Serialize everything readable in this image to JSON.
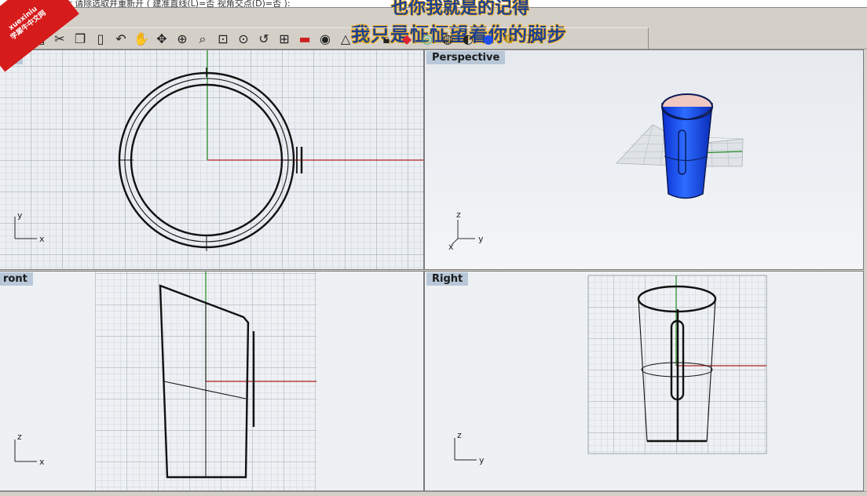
{
  "command_line": "ter 请除选取并重新开 ( 建准直线(L)=否  视角交点(D)=否 ):",
  "banner_top": "也你我就是的记得",
  "banner": "我只是怔怔望着你的脚步",
  "watermark": {
    "line1": "xuexiniu",
    "line2": "学犀牛中文网"
  },
  "toolbar": {
    "icons": [
      "print-icon",
      "page-setup-icon",
      "cut-icon",
      "copy-icon",
      "paste-icon",
      "undo-icon",
      "pan-hand-icon",
      "rotate-view-icon",
      "zoom-icon",
      "zoom-window-icon",
      "zoom-extents-icon",
      "zoom-selected-icon",
      "undo-view-icon",
      "four-viewports-icon",
      "car-icon",
      "construction-plane-icon",
      "point-osnap-icon",
      "lightbulb-icon",
      "lock-icon",
      "layer-icon",
      "color-wheel-icon",
      "sphere-wireframe-icon",
      "sphere-shaded-icon",
      "render-sphere-icon",
      "settings-gear-icon",
      "dimension-icon",
      "help-icon"
    ]
  },
  "viewports": {
    "top": {
      "title": "op",
      "axis_x": "x",
      "axis_y": "y"
    },
    "perspective": {
      "title": "Perspective",
      "axis_z": "z",
      "axis_y": "y",
      "axis_x": "x"
    },
    "front": {
      "title": "ront",
      "axis_z": "z",
      "axis_x": "x"
    },
    "right": {
      "title": "Right",
      "axis_z": "z",
      "axis_y": "y"
    }
  },
  "colors": {
    "grid_minor": "#c5ccd3",
    "grid_major": "#9aa2aa",
    "x_axis": "#b12222",
    "y_axis": "#1e8a1e",
    "viewport_bg": "#ebeef2",
    "title_bg": "#b9c8d8",
    "surface_blue": "#1f4fe8",
    "surface_inside": "#f0c8c2"
  }
}
